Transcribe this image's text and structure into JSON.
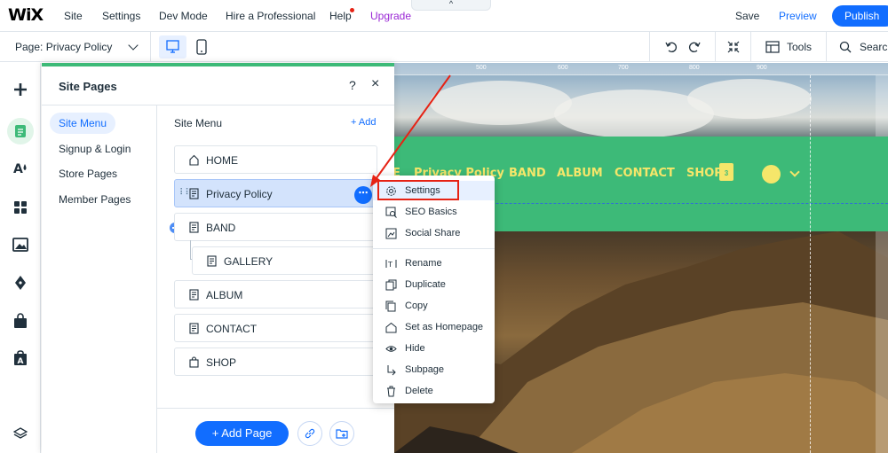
{
  "topbar": {
    "logo": "WiX",
    "nav": [
      "Site",
      "Settings",
      "Dev Mode",
      "Hire a Professional",
      "Help",
      "Upgrade"
    ],
    "collapse_icon": "^",
    "save": "Save",
    "preview": "Preview",
    "publish": "Publish"
  },
  "toolbar": {
    "page_label": "Page: Privacy Policy",
    "tools": "Tools",
    "search": "Search"
  },
  "panel": {
    "title": "Site Pages",
    "help": "?",
    "close": "×",
    "side_tabs": [
      "Site Menu",
      "Signup & Login",
      "Store Pages",
      "Member Pages"
    ],
    "menu_title": "Site Menu",
    "add_link": "+ Add",
    "pages": [
      "HOME",
      "Privacy Policy",
      "BAND",
      "GALLERY",
      "ALBUM",
      "CONTACT",
      "SHOP"
    ],
    "drag_dots": "⠇⠇",
    "more": "⋯",
    "add_page": "+ Add Page"
  },
  "context_menu": {
    "items": [
      "Settings",
      "SEO Basics",
      "Social Share",
      "Rename",
      "Duplicate",
      "Copy",
      "Set as Homepage",
      "Hide",
      "Subpage",
      "Delete"
    ]
  },
  "canvas": {
    "ruler_labels": [
      "500",
      "600",
      "700",
      "800",
      "900"
    ],
    "site_nav": [
      "E",
      "Privacy Policy",
      "BAND",
      "ALBUM",
      "CONTACT",
      "SHOP"
    ],
    "cart_count": "3"
  },
  "colors": {
    "accent": "#116dff",
    "site_green": "#3dba78",
    "site_nav_text": "#f5e66a",
    "annotation_red": "#e62214",
    "upgrade": "#9a27d5"
  }
}
